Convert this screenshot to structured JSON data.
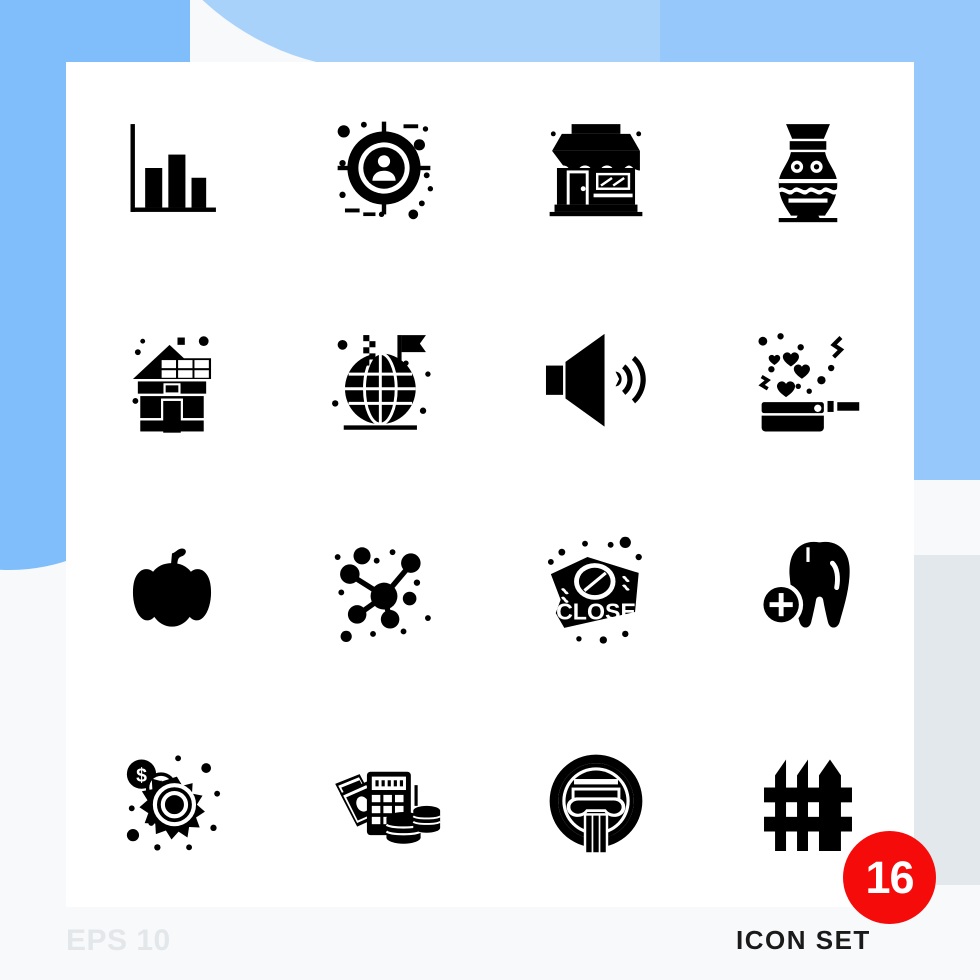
{
  "meta": {
    "eps_label": "EPS 10",
    "set_label": "ICON SET",
    "count": "16",
    "badge_color": "#f60b0b",
    "background_color": "#f7f9fb",
    "card_color": "#ffffff",
    "icon_color": "#000000",
    "accent_blue": "#96c8fb",
    "accent_grey": "#e2e8eb"
  },
  "icons": [
    {
      "index": 1,
      "row": 1,
      "col": 1,
      "name": "bar-chart-icon",
      "label": "Bar Chart"
    },
    {
      "index": 2,
      "row": 1,
      "col": 2,
      "name": "user-target-icon",
      "label": "User Target"
    },
    {
      "index": 3,
      "row": 1,
      "col": 3,
      "name": "shop-store-icon",
      "label": "Shop"
    },
    {
      "index": 4,
      "row": 1,
      "col": 4,
      "name": "vase-pottery-icon",
      "label": "Vase"
    },
    {
      "index": 5,
      "row": 2,
      "col": 1,
      "name": "solar-house-icon",
      "label": "Solar House"
    },
    {
      "index": 6,
      "row": 2,
      "col": 2,
      "name": "globe-flag-icon",
      "label": "Globe Flag"
    },
    {
      "index": 7,
      "row": 2,
      "col": 3,
      "name": "volume-speaker-icon",
      "label": "Volume"
    },
    {
      "index": 8,
      "row": 2,
      "col": 4,
      "name": "confetti-popper-icon",
      "label": "Confetti"
    },
    {
      "index": 9,
      "row": 3,
      "col": 1,
      "name": "pumpkin-icon",
      "label": "Pumpkin"
    },
    {
      "index": 10,
      "row": 3,
      "col": 2,
      "name": "network-molecule-icon",
      "label": "Network"
    },
    {
      "index": 11,
      "row": 3,
      "col": 3,
      "name": "close-sign-icon",
      "label": "Close Sign"
    },
    {
      "index": 12,
      "row": 3,
      "col": 4,
      "name": "tooth-add-icon",
      "label": "Add Tooth"
    },
    {
      "index": 13,
      "row": 4,
      "col": 1,
      "name": "money-gear-icon",
      "label": "Money Gear"
    },
    {
      "index": 14,
      "row": 4,
      "col": 2,
      "name": "calculator-money-icon",
      "label": "Accounting"
    },
    {
      "index": 15,
      "row": 4,
      "col": 3,
      "name": "pillar-column-icon",
      "label": "Pillar"
    },
    {
      "index": 16,
      "row": 4,
      "col": 4,
      "name": "fence-icon",
      "label": "Fence"
    }
  ],
  "icon_text": {
    "close_sign": "CLOSE",
    "dollar_sign": "$"
  }
}
